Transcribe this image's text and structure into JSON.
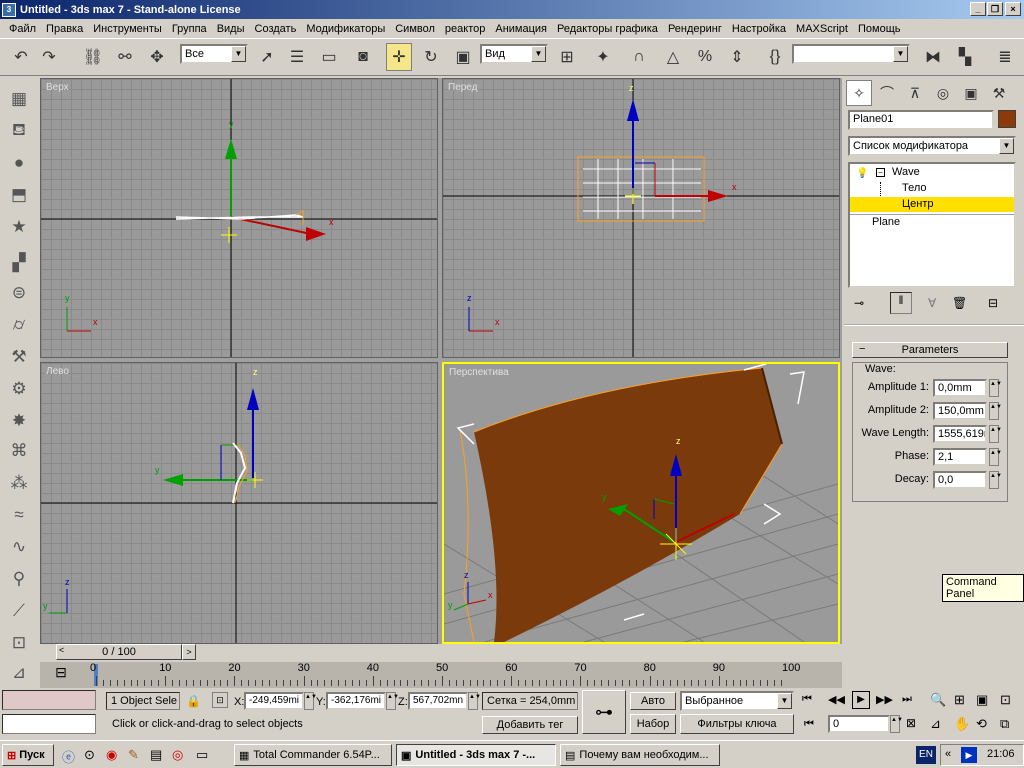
{
  "window": {
    "title": "Untitled - 3ds max 7 - Stand-alone License",
    "icon": "3ds-max-icon"
  },
  "menu": [
    "Файл",
    "Правка",
    "Инструменты",
    "Группа",
    "Виды",
    "Создать",
    "Модификаторы",
    "Символ",
    "реактор",
    "Анимация",
    "Редакторы графика",
    "Рендеринг",
    "Настройка",
    "MAXScript",
    "Помощь"
  ],
  "toolbar": {
    "selection_filter": "Все",
    "coord_system": "Вид",
    "named_selection": ""
  },
  "viewports": {
    "top": "Верх",
    "front": "Перед",
    "left": "Лево",
    "perspective": "Перспектива"
  },
  "axes": {
    "x": "x",
    "y": "y",
    "z": "z"
  },
  "command_panel": {
    "object_name": "Plane01",
    "object_color": "#8b3a0a",
    "modifier_list": "Список модификатора",
    "stack": [
      {
        "label": "Wave",
        "level": 0
      },
      {
        "label": "Тело",
        "level": 1
      },
      {
        "label": "Центр",
        "level": 1,
        "selected": true
      },
      {
        "label": "Plane",
        "level": 0
      }
    ],
    "rollout_title": "Parameters",
    "group_title": "Wave:",
    "params": [
      {
        "label": "Amplitude 1:",
        "value": "0,0mm"
      },
      {
        "label": "Amplitude 2:",
        "value": "150,0mm"
      },
      {
        "label": "Wave Length:",
        "value": "1555,619r"
      },
      {
        "label": "Phase:",
        "value": "2,1"
      },
      {
        "label": "Decay:",
        "value": "0,0"
      }
    ]
  },
  "tooltip": "Command Panel",
  "timeline": {
    "frame": "0 / 100",
    "ticks": [
      "0",
      "10",
      "20",
      "30",
      "40",
      "50",
      "60",
      "70",
      "80",
      "90",
      "100"
    ]
  },
  "status": {
    "selection": "1 Object Sele",
    "x_label": "X:",
    "x": "-249,459mi",
    "y_label": "Y:",
    "y": "-362,176mi",
    "z_label": "Z:",
    "z": "567,702mn",
    "grid": "Сетка = 254,0mm",
    "prompt": "Click or click-and-drag to select objects",
    "add_tag": "Добавить тег",
    "auto": "Авто",
    "set": "Набор",
    "key_mode": "Выбранное",
    "key_filters": "Фильтры ключа",
    "frame_field": "0"
  },
  "taskbar": {
    "start": "Пуск",
    "tasks": [
      "Total Commander 6.54P...",
      "Untitled - 3ds max 7 -...",
      "Почему вам необходим..."
    ],
    "lang": "EN",
    "clock": "21:06"
  },
  "colors": {
    "accent": "#0a246a",
    "selection": "#ffff00",
    "stack_highlight": "#ffe000",
    "object": "#8b3a0a"
  }
}
